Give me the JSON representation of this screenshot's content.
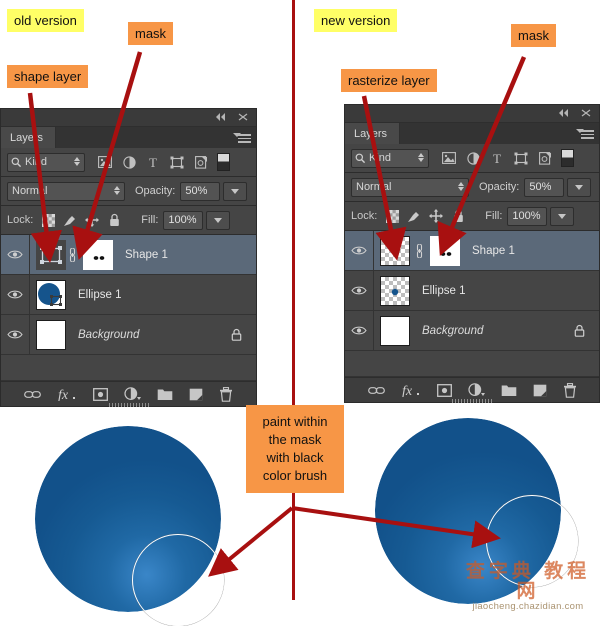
{
  "callouts": [
    {
      "id": "old-version",
      "text": "old version",
      "style": "yellow"
    },
    {
      "id": "mask-left",
      "text": "mask",
      "style": "orange"
    },
    {
      "id": "shape-layer",
      "text": "shape layer",
      "style": "orange"
    },
    {
      "id": "new-version",
      "text": "new version",
      "style": "yellow"
    },
    {
      "id": "rasterize-layer",
      "text": "rasterize layer",
      "style": "orange"
    },
    {
      "id": "mask-right",
      "text": "mask",
      "style": "orange"
    },
    {
      "id": "paint-note",
      "text": "paint within\nthe mask\nwith black\ncolor brush",
      "style": "orange"
    }
  ],
  "panels": {
    "left": {
      "tab_label": "Layers",
      "titlebar": {
        "collapse_icon": "collapse-icon",
        "close_icon": "close-icon"
      },
      "filter": {
        "kind_label": "Kind",
        "search_icon": "search-icon",
        "icons": [
          "image-filter-icon",
          "adjustment-filter-icon",
          "type-filter-icon",
          "shape-filter-icon",
          "smart-object-filter-icon"
        ],
        "toggle_icon": "filter-toggle-icon"
      },
      "blend": {
        "mode": "Normal",
        "opacity_label": "Opacity:",
        "opacity_value": "50%"
      },
      "lock": {
        "label": "Lock:",
        "fill_label": "Fill:",
        "fill_value": "100%",
        "icons": [
          "lock-transparency-icon",
          "lock-image-icon",
          "lock-position-icon",
          "lock-all-icon"
        ]
      },
      "layers": [
        {
          "name": "Shape 1",
          "selected": true,
          "thumb": "vector-shape",
          "has_link": true,
          "has_mask": true,
          "locked": false,
          "italic": false
        },
        {
          "name": "Ellipse 1",
          "selected": false,
          "thumb": "blue-ellipse-vector",
          "has_link": false,
          "has_mask": false,
          "locked": false,
          "italic": false
        },
        {
          "name": "Background",
          "selected": false,
          "thumb": "white",
          "has_link": false,
          "has_mask": false,
          "locked": true,
          "italic": true
        }
      ],
      "bottom_icons": [
        "link-layers-icon",
        "fx-icon",
        "add-mask-icon",
        "adjustment-layer-icon",
        "new-group-icon",
        "new-layer-icon",
        "delete-layer-icon"
      ]
    },
    "right": {
      "tab_label": "Layers",
      "titlebar": {
        "collapse_icon": "collapse-icon",
        "close_icon": "close-icon"
      },
      "filter": {
        "kind_label": "Kind",
        "search_icon": "search-icon",
        "icons": [
          "image-filter-icon",
          "adjustment-filter-icon",
          "type-filter-icon",
          "shape-filter-icon",
          "smart-object-filter-icon"
        ],
        "toggle_icon": "filter-toggle-icon"
      },
      "blend": {
        "mode": "Normal",
        "opacity_label": "Opacity:",
        "opacity_value": "50%"
      },
      "lock": {
        "label": "Lock:",
        "fill_label": "Fill:",
        "fill_value": "100%",
        "icons": [
          "lock-transparency-icon",
          "lock-image-icon",
          "lock-position-icon",
          "lock-all-icon"
        ]
      },
      "layers": [
        {
          "name": "Shape 1",
          "selected": true,
          "thumb": "transparent",
          "has_link": true,
          "has_mask": true,
          "locked": false,
          "italic": false
        },
        {
          "name": "Ellipse 1",
          "selected": false,
          "thumb": "small-blue-dot",
          "has_link": false,
          "has_mask": false,
          "locked": false,
          "italic": false
        },
        {
          "name": "Background",
          "selected": false,
          "thumb": "white",
          "has_link": false,
          "has_mask": false,
          "locked": true,
          "italic": true
        }
      ],
      "bottom_icons": [
        "link-layers-icon",
        "fx-icon",
        "add-mask-icon",
        "adjustment-layer-icon",
        "new-group-icon",
        "new-layer-icon",
        "delete-layer-icon"
      ]
    }
  },
  "canvas": {
    "left_shape": {
      "name": "blue-gradient-circle-old"
    },
    "right_shape": {
      "name": "blue-gradient-circle-new"
    },
    "brush_cursor_label": "brush-cursor"
  },
  "watermark": {
    "cn": "查字典 教程网",
    "en": "jiaocheng.chazidian.com"
  },
  "colors": {
    "callout_orange": "#f79646",
    "callout_yellow": "#ffff66",
    "arrow_red": "#a81010",
    "divider_red": "#a81010",
    "shape_blue": "#15548c",
    "panel_bg": "#454545",
    "selected_row": "#5b6979"
  }
}
